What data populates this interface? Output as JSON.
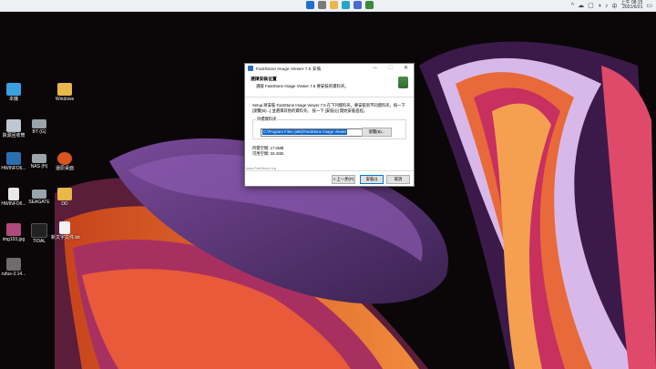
{
  "taskbar": {
    "lang": "中",
    "time": "上午 08:15",
    "date": "2021/6/21",
    "tray_glyphs": [
      "^",
      "☁",
      "▢",
      "◑",
      "♪"
    ]
  },
  "desktop": {
    "icons": [
      {
        "name": "this-pc",
        "label": "本機",
        "color": "#3aa0e0"
      },
      {
        "name": "windows-folder",
        "label": "Windows",
        "color": "#e8b84a"
      },
      {
        "name": "recycle-bin",
        "label": "資源回收筒",
        "color": "#bfc7d0"
      },
      {
        "name": "bt-drive",
        "label": "BT (G)",
        "color": "#9aa4ad"
      },
      {
        "name": "hwinfo64",
        "label": "HWINFO6...",
        "color": "#2c6fb0"
      },
      {
        "name": "nas-drive",
        "label": "NAS (H)",
        "color": "#9aa4ad"
      },
      {
        "name": "restore-desktop",
        "label": "還原桌面",
        "color": "#d9541e"
      },
      {
        "name": "hwinfo64-2",
        "label": "HWINFO6...",
        "color": "#e8e8e8"
      },
      {
        "name": "seagate-drive",
        "label": "SEAGATE",
        "color": "#9aa4ad"
      },
      {
        "name": "dd-folder",
        "label": "DD",
        "color": "#e8b84a"
      },
      {
        "name": "img-file",
        "label": "img103.jpg",
        "color": "#b04a7a"
      },
      {
        "name": "tidal",
        "label": "TIDAL",
        "color": "#222222"
      },
      {
        "name": "text-file",
        "label": "新文字文件.txt",
        "color": "#f2f2f2"
      },
      {
        "name": "rufus",
        "label": "rufus-3.14...",
        "color": "#6d6d6d"
      }
    ]
  },
  "dialog": {
    "title": "FastStone Image Viewer 7.5 安裝",
    "minimize": "─",
    "maximize": "☐",
    "close": "✕",
    "header_title": "選擇安裝位置",
    "header_sub": "選取 FastStone Image Viewer 7.5 要安裝的資料夾。",
    "description": "Setup 將安裝 FastStone Image Viewer 7.5 在下列資料夾。要安裝到不同資料夾，按一下 [瀏覽(B)...] 並選擇其他的資料夾。 按一下 [安裝(I)] 開始安裝進程。",
    "group_label": "目標資料夾",
    "path_value": "C:\\Program Files (x86)\\FastStone Image Viewer",
    "browse_label": "瀏覽(B)...",
    "space_required": "所需空間: 17.0MB",
    "space_available": "可用空間: 33.4GB",
    "brand_text": "www.FastStone.org",
    "back_label": "< 上一步(P)",
    "install_label": "安裝(I)",
    "cancel_label": "取消"
  }
}
